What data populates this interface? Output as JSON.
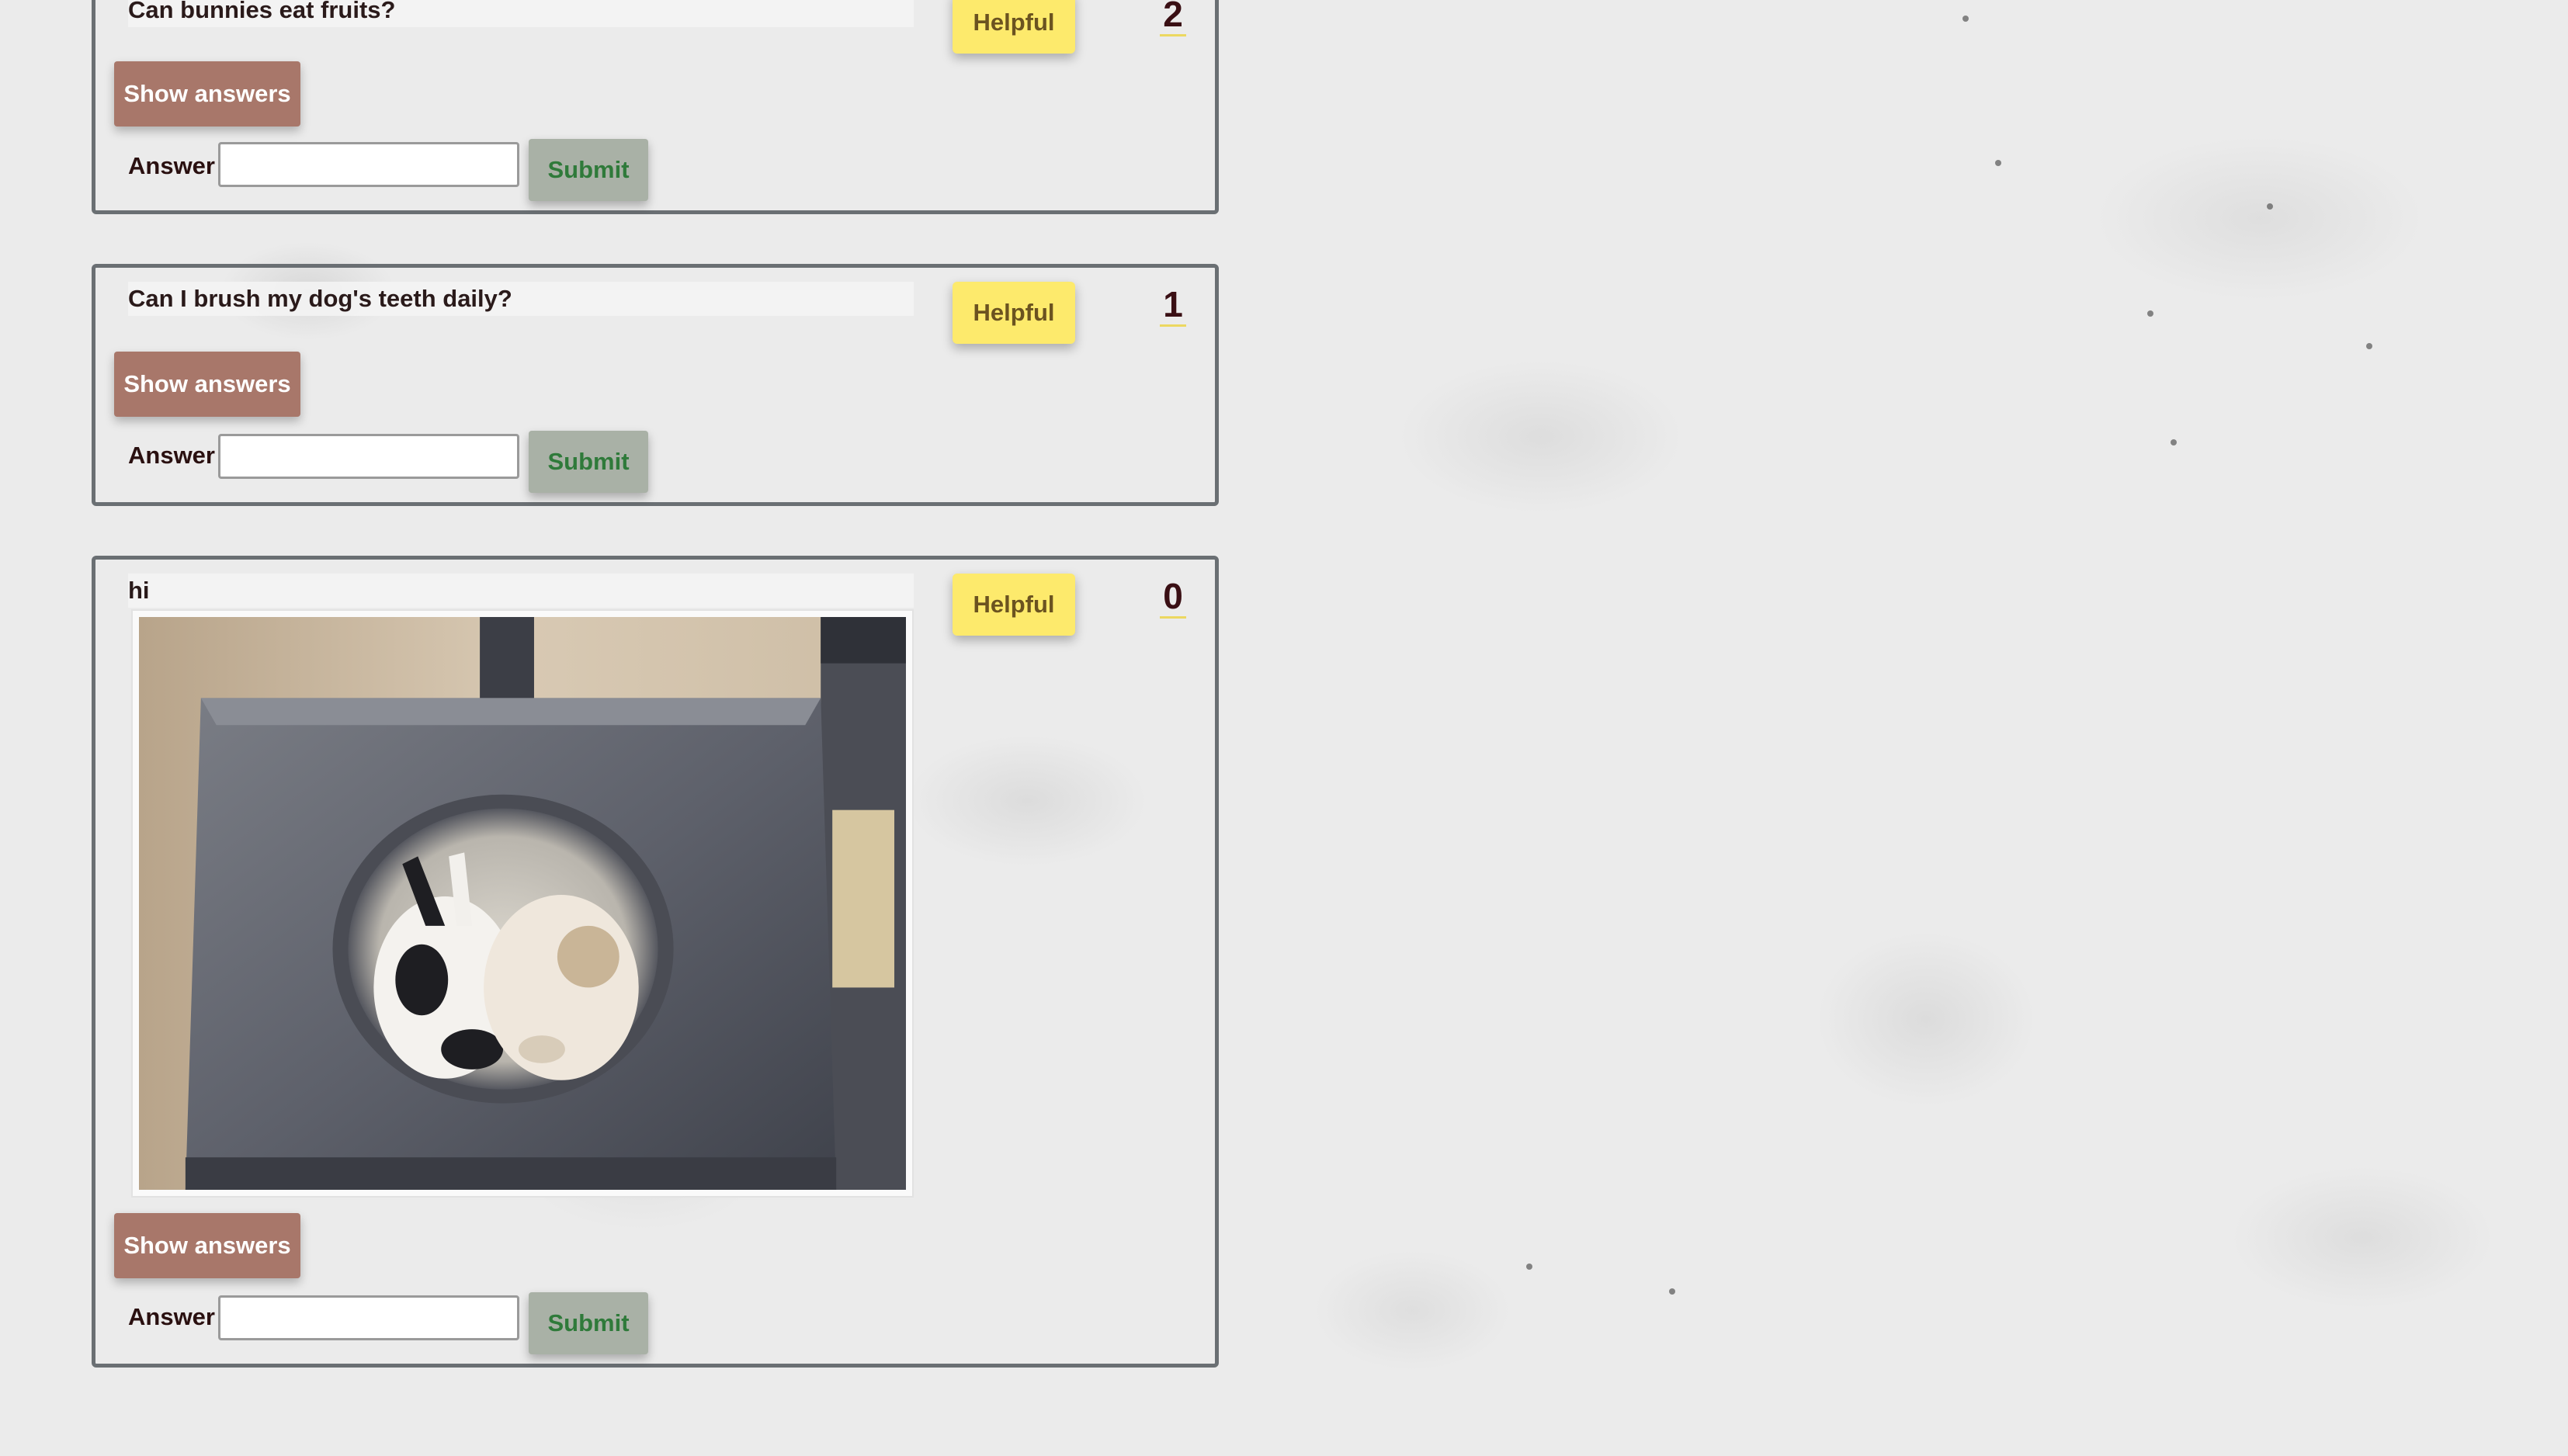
{
  "questions": [
    {
      "text": "Can bunnies eat fruits?",
      "helpful_label": "Helpful",
      "helpful_count": "2",
      "show_answers_label": "Show answers",
      "answer_label": "Answer",
      "answer_value": "",
      "submit_label": "Submit"
    },
    {
      "text": "Can I brush my dog's teeth daily?",
      "helpful_label": "Helpful",
      "helpful_count": "1",
      "show_answers_label": "Show answers",
      "answer_label": "Answer",
      "answer_value": "",
      "submit_label": "Submit"
    },
    {
      "text": "hi",
      "helpful_label": "Helpful",
      "helpful_count": "0",
      "show_answers_label": "Show answers",
      "answer_label": "Answer",
      "answer_value": "",
      "submit_label": "Submit",
      "image": "rabbits-in-cat-tree-photo"
    }
  ],
  "colors": {
    "helpful_button": "#fdea6c",
    "show_answers_button": "#a8776a",
    "submit_button": "#a9b1a6",
    "submit_text": "#2f7a3a",
    "card_border": "#6a6f73"
  }
}
